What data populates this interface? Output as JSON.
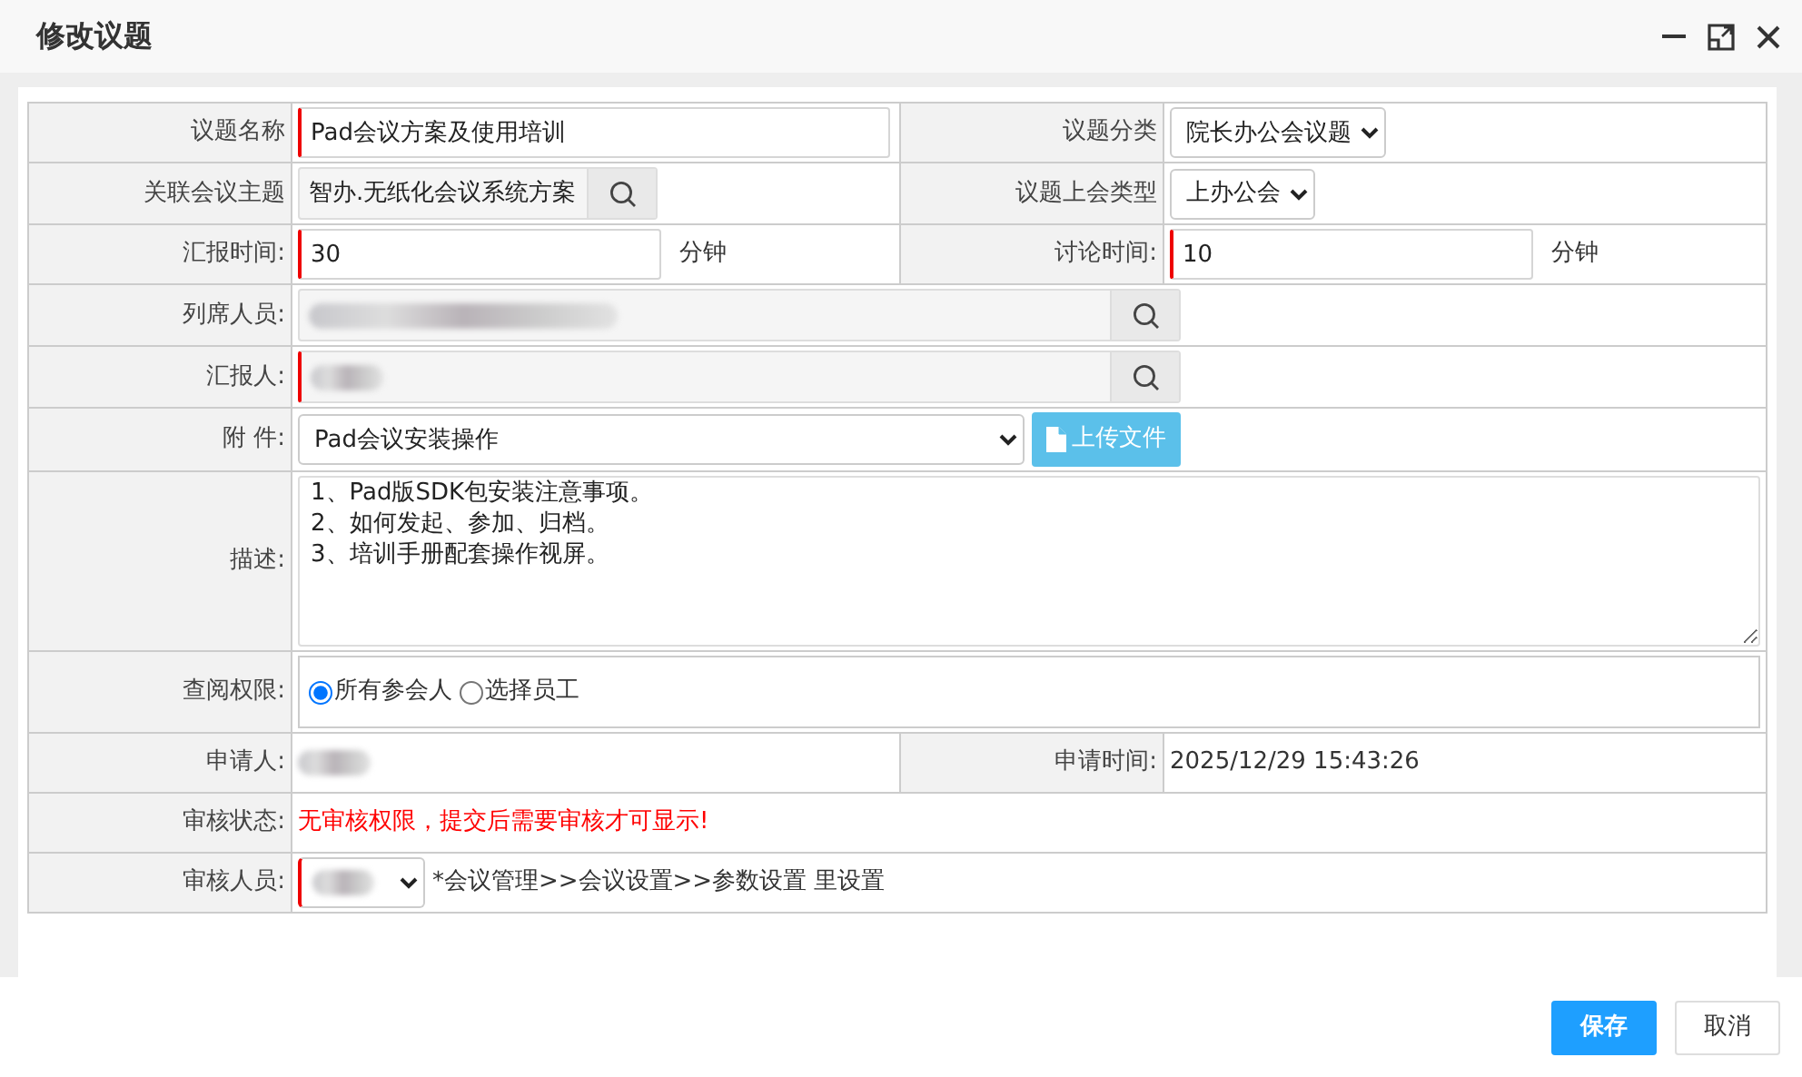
{
  "dialog": {
    "title": "修改议题"
  },
  "rows": [
    {
      "fields": [
        {
          "label": "议题名称",
          "kind": "text",
          "value": "Pad会议方案及使用培训",
          "required": true
        },
        {
          "label": "议题分类",
          "kind": "select",
          "value": "院长办公会议题",
          "required": false
        }
      ]
    },
    {
      "fields": [
        {
          "label": "关联会议主题",
          "kind": "picker",
          "value": "智办.无纸化会议系统方案",
          "required": false
        },
        {
          "label": "议题上会类型",
          "kind": "select",
          "value": "上办公会",
          "required": false
        }
      ]
    },
    {
      "fields": [
        {
          "label": "汇报时间:",
          "kind": "text",
          "value": "30",
          "unit": "分钟",
          "required": true
        },
        {
          "label": "讨论时间:",
          "kind": "text",
          "value": "10",
          "unit": "分钟",
          "required": true
        }
      ]
    },
    {
      "fields": [
        {
          "label": "列席人员:",
          "kind": "picker",
          "redacted": true,
          "required": false
        }
      ]
    },
    {
      "fields": [
        {
          "label": "汇报人:",
          "kind": "picker",
          "redacted": true,
          "required": true
        }
      ]
    },
    {
      "fields": [
        {
          "label": "附 件:",
          "kind": "file",
          "value": "Pad会议安装操作",
          "button": "上传文件"
        }
      ]
    },
    {
      "fields": [
        {
          "label": "描述:",
          "kind": "textarea",
          "value": "1、Pad版SDK包安装注意事项。\n2、如何发起、参加、归档。\n3、培训手册配套操作视屏。"
        }
      ]
    },
    {
      "fields": [
        {
          "label": "查阅权限:",
          "kind": "radios",
          "options": [
            {
              "label": "所有参会人",
              "selected": true
            },
            {
              "label": "选择员工",
              "selected": false
            }
          ]
        }
      ]
    },
    {
      "fields": [
        {
          "label": "申请人:",
          "kind": "static",
          "redacted": true
        },
        {
          "label": "申请时间:",
          "kind": "static",
          "value": "2025/12/29 15:43:26"
        }
      ]
    },
    {
      "fields": [
        {
          "label": "审核状态:",
          "kind": "static",
          "value": "无审核权限，提交后需要审核才可显示!",
          "alert": true
        }
      ]
    },
    {
      "fields": [
        {
          "label": "审核人员:",
          "kind": "select",
          "redacted": true,
          "required": true,
          "note": "*会议管理>>会议设置>>参数设置 里设置"
        }
      ]
    }
  ],
  "buttons": [
    {
      "label": "保存",
      "primary": true
    },
    {
      "label": "取消",
      "primary": false
    }
  ]
}
